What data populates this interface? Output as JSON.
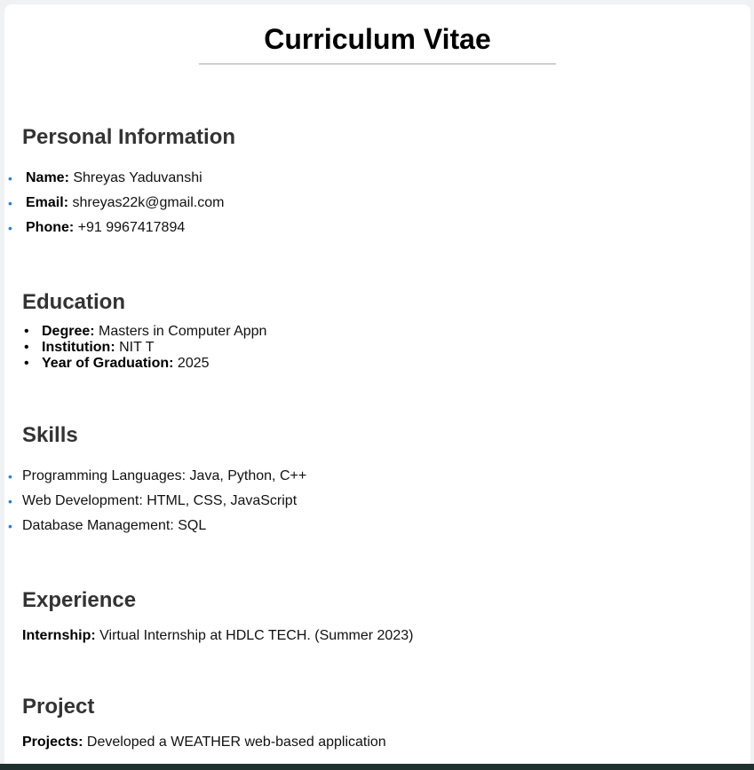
{
  "title": "Curriculum Vitae",
  "personal": {
    "heading": "Personal Information",
    "items": [
      {
        "label": "Name:",
        "value": "Shreyas Yaduvanshi"
      },
      {
        "label": "Email:",
        "value": "shreyas22k@gmail.com"
      },
      {
        "label": "Phone:",
        "value": "+91 9967417894"
      }
    ]
  },
  "education": {
    "heading": "Education",
    "items": [
      {
        "label": "Degree:",
        "value": "Masters in Computer Appn"
      },
      {
        "label": "Institution:",
        "value": "NIT T"
      },
      {
        "label": "Year of Graduation:",
        "value": "2025"
      }
    ]
  },
  "skills": {
    "heading": "Skills",
    "items": [
      "Programming Languages: Java, Python, C++",
      "Web Development: HTML, CSS, JavaScript",
      "Database Management: SQL"
    ]
  },
  "experience": {
    "heading": "Experience",
    "label": "Internship:",
    "value": "Virtual Internship at HDLC TECH. (Summer 2023)"
  },
  "project": {
    "heading": "Project",
    "label": "Projects:",
    "value": "Developed a WEATHER web-based application"
  },
  "colors": {
    "bullet_accent": "#2f7fd0",
    "heading_text": "#333333",
    "rule": "#cfcfcf"
  }
}
